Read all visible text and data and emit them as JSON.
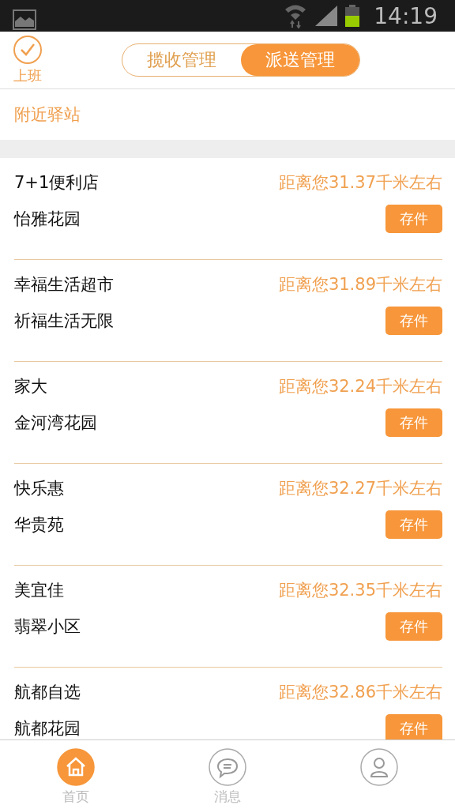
{
  "status_bar": {
    "time": "14:19"
  },
  "header": {
    "checkin": {
      "label": "上班",
      "checked": true
    },
    "tabs": [
      {
        "label": "揽收管理",
        "selected": false
      },
      {
        "label": "派送管理",
        "selected": true
      }
    ]
  },
  "section_title": "附近驿站",
  "stations": [
    {
      "name": "7+1便利店",
      "address": "怡雅花园",
      "distance": "距离您31.37千米左右",
      "action": "存件"
    },
    {
      "name": "幸福生活超市",
      "address": "祈福生活无限",
      "distance": "距离您31.89千米左右",
      "action": "存件"
    },
    {
      "name": "家大",
      "address": "金河湾花园",
      "distance": "距离您32.24千米左右",
      "action": "存件"
    },
    {
      "name": "快乐惠",
      "address": "华贵苑",
      "distance": "距离您32.27千米左右",
      "action": "存件"
    },
    {
      "name": "美宜佳",
      "address": "翡翠小区",
      "distance": "距离您32.35千米左右",
      "action": "存件"
    },
    {
      "name": "航都自选",
      "address": "航都花园",
      "distance": "距离您32.86千米左右",
      "action": "存件"
    }
  ],
  "bottom_nav": [
    {
      "kind": "home",
      "label": "首页",
      "selected": true
    },
    {
      "kind": "message",
      "label": "消息",
      "selected": false
    },
    {
      "kind": "profile",
      "selected": false
    }
  ]
}
